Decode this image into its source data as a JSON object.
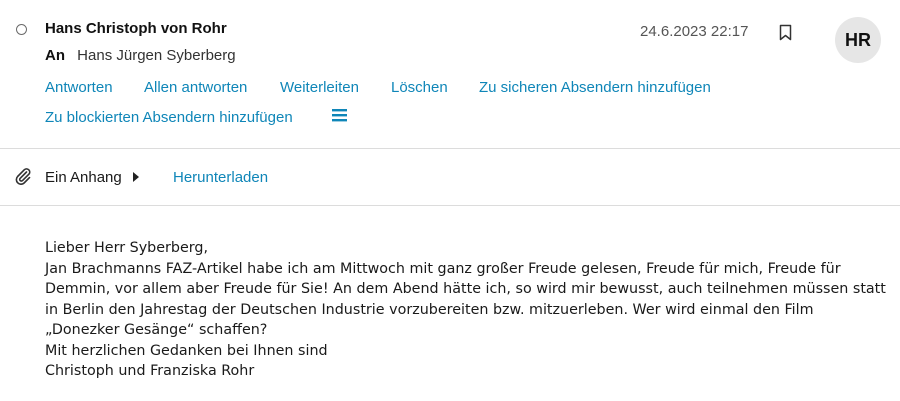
{
  "header": {
    "sender": "Hans Christoph von Rohr",
    "to_label": "An",
    "to_name": "Hans Jürgen Syberberg",
    "date": "24.6.2023 22:17",
    "avatar_initials": "HR",
    "bookmark_icon": "bookmark-icon"
  },
  "actions": {
    "reply": "Antworten",
    "reply_all": "Allen antworten",
    "forward": "Weiterleiten",
    "delete": "Löschen",
    "add_safe_sender": "Zu sicheren Absendern hinzufügen",
    "add_blocked_sender": "Zu blockierten Absendern hinzufügen",
    "more_icon": "hamburger-menu-icon"
  },
  "attachment": {
    "icon": "paperclip-icon",
    "label": "Ein Anhang",
    "download": "Herunterladen"
  },
  "message": {
    "lines": [
      "Lieber Herr Syberberg,",
      "Jan Brachmanns FAZ-Artikel habe ich am Mittwoch mit ganz großer Freude gelesen, Freude für mich, Freude für",
      "Demmin, vor allem aber Freude für Sie! An dem Abend hätte ich, so wird mir bewusst, auch teilnehmen müssen statt",
      "in Berlin den Jahrestag der Deutschen Industrie vorzubereiten bzw. mitzuerleben. Wer wird einmal den Film",
      "„Donezker Gesänge“ schaffen?",
      "Mit herzlichen Gedanken bei Ihnen sind",
      "Christoph und Franziska Rohr"
    ]
  },
  "colors": {
    "link": "#0f86b8",
    "avatar_bg": "#e6e6e6",
    "divider": "#dcdcdc"
  }
}
